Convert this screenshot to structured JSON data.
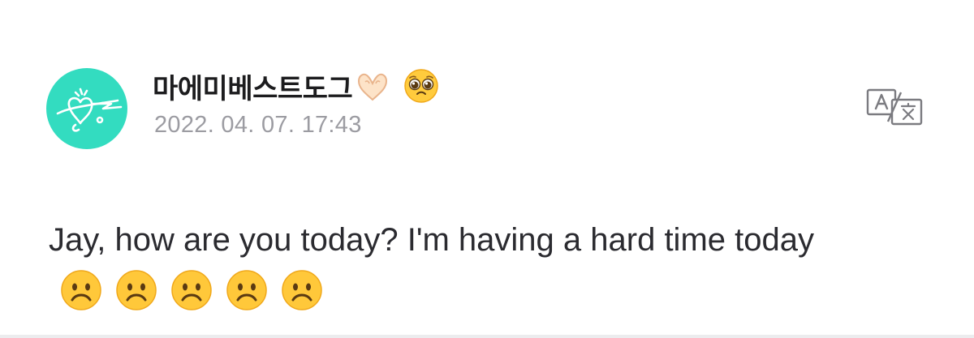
{
  "post": {
    "author": "마에미베스트도그",
    "author_emojis": [
      "heart-hands-emoji",
      "pleading-face-emoji"
    ],
    "timestamp": "2022. 04. 07. 17:43",
    "message": "Jay, how are you today? I'm having a hard time today",
    "message_emojis": [
      "frowning-face-emoji",
      "frowning-face-emoji",
      "frowning-face-emoji",
      "frowning-face-emoji",
      "frowning-face-emoji"
    ]
  },
  "icons": {
    "translate": "translate-icon"
  },
  "colors": {
    "avatar_bg": "#33dcc0",
    "timestamp": "#9c9ca2",
    "text": "#2b2b30"
  }
}
